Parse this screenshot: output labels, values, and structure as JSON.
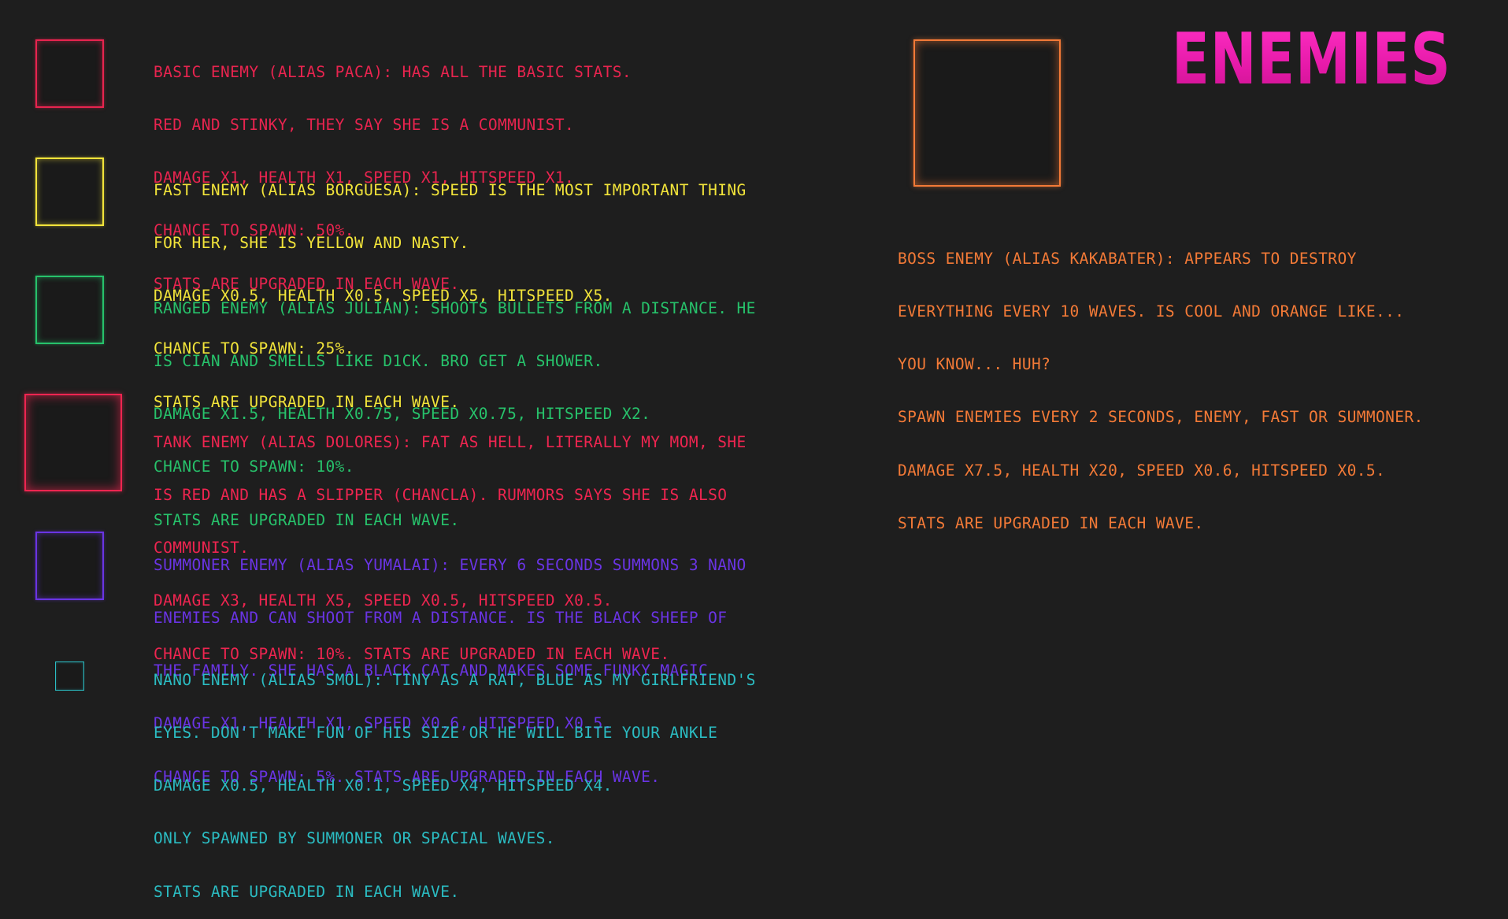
{
  "title": "ENEMIES",
  "colors": {
    "background": "#1e1e1e",
    "basic": "#e8244f",
    "fast": "#f2e43a",
    "ranged": "#27c26b",
    "tank": "#ee2550",
    "summoner": "#6a34e4",
    "nano": "#2bbcc2",
    "boss": "#f37a37",
    "title": "#ea1ab0"
  },
  "enemies": [
    {
      "id": "basic",
      "icon": "red-square-icon",
      "lines": [
        "BASIC ENEMY (ALIAS PACA): HAS ALL THE BASIC STATS.",
        "RED AND STINKY, THEY SAY SHE IS A COMMUNIST.",
        "DAMAGE X1, HEALTH X1, SPEED X1, HITSPEED X1.",
        "CHANCE TO SPAWN: 50%.",
        "STATS ARE UPGRADED IN EACH WAVE."
      ]
    },
    {
      "id": "fast",
      "icon": "yellow-square-icon",
      "lines": [
        "FAST ENEMY (ALIAS BORGUESA): SPEED IS THE MOST IMPORTANT THING",
        "FOR HER, SHE IS YELLOW AND NASTY.",
        "DAMAGE X0.5, HEALTH X0.5, SPEED X5, HITSPEED X5.",
        "CHANCE TO SPAWN: 25%.",
        "STATS ARE UPGRADED IN EACH WAVE."
      ]
    },
    {
      "id": "ranged",
      "icon": "green-square-icon",
      "lines": [
        "RANGED ENEMY (ALIAS JULIAN): SHOOTS BULLETS FROM A DISTANCE. HE",
        "IS CIAN AND SMELLS LIKE D1CK. BRO GET A SHOWER.",
        "DAMAGE X1.5, HEALTH X0.75, SPEED X0.75, HITSPEED X2.",
        "CHANCE TO SPAWN: 10%.",
        "STATS ARE UPGRADED IN EACH WAVE."
      ]
    },
    {
      "id": "tank",
      "icon": "large-red-square-icon",
      "lines": [
        "TANK ENEMY (ALIAS DOLORES): FAT AS HELL, LITERALLY MY MOM, SHE",
        "IS RED AND HAS A SLIPPER (CHANCLA). RUMMORS SAYS SHE IS ALSO",
        "COMMUNIST.",
        "DAMAGE X3, HEALTH X5, SPEED X0.5, HITSPEED X0.5.",
        "CHANCE TO SPAWN: 10%. STATS ARE UPGRADED IN EACH WAVE."
      ]
    },
    {
      "id": "summoner",
      "icon": "purple-square-icon",
      "lines": [
        "SUMMONER ENEMY (ALIAS YUMALAI): EVERY 6 SECONDS SUMMONS 3 NANO",
        "ENEMIES AND CAN SHOOT FROM A DISTANCE. IS THE BLACK SHEEP OF",
        "THE FAMILY. SHE HAS A BLACK CAT AND MAKES SOME FUNKY MAGIC",
        "DAMAGE X1, HEALTH X1, SPEED X0.6, HITSPEED X0.5.",
        "CHANCE TO SPAWN: 5%. STATS ARE UPGRADED IN EACH WAVE."
      ]
    },
    {
      "id": "nano",
      "icon": "small-cyan-square-icon",
      "lines": [
        "NANO ENEMY (ALIAS SMOL): TINY AS A RAT, BLUE AS MY GIRLFRIEND'S",
        "EYES. DON'T MAKE FUN OF HIS SIZE OR HE WILL BITE YOUR ANKLE",
        "DAMAGE X0.5, HEALTH X0.1, SPEED X4, HITSPEED X4.",
        "ONLY SPAWNED BY SUMMONER OR SPACIAL WAVES.",
        "STATS ARE UPGRADED IN EACH WAVE."
      ]
    }
  ],
  "boss": {
    "id": "boss",
    "icon": "orange-square-icon",
    "lines": [
      "BOSS ENEMY (ALIAS KAKABATER): APPEARS TO DESTROY",
      "EVERYTHING EVERY 10 WAVES. IS COOL AND ORANGE LIKE...",
      "YOU KNOW... HUH?",
      "SPAWN ENEMIES EVERY 2 SECONDS, ENEMY, FAST OR SUMMONER.",
      "DAMAGE X7.5, HEALTH X20, SPEED X0.6, HITSPEED X0.5.",
      "STATS ARE UPGRADED IN EACH WAVE."
    ]
  }
}
